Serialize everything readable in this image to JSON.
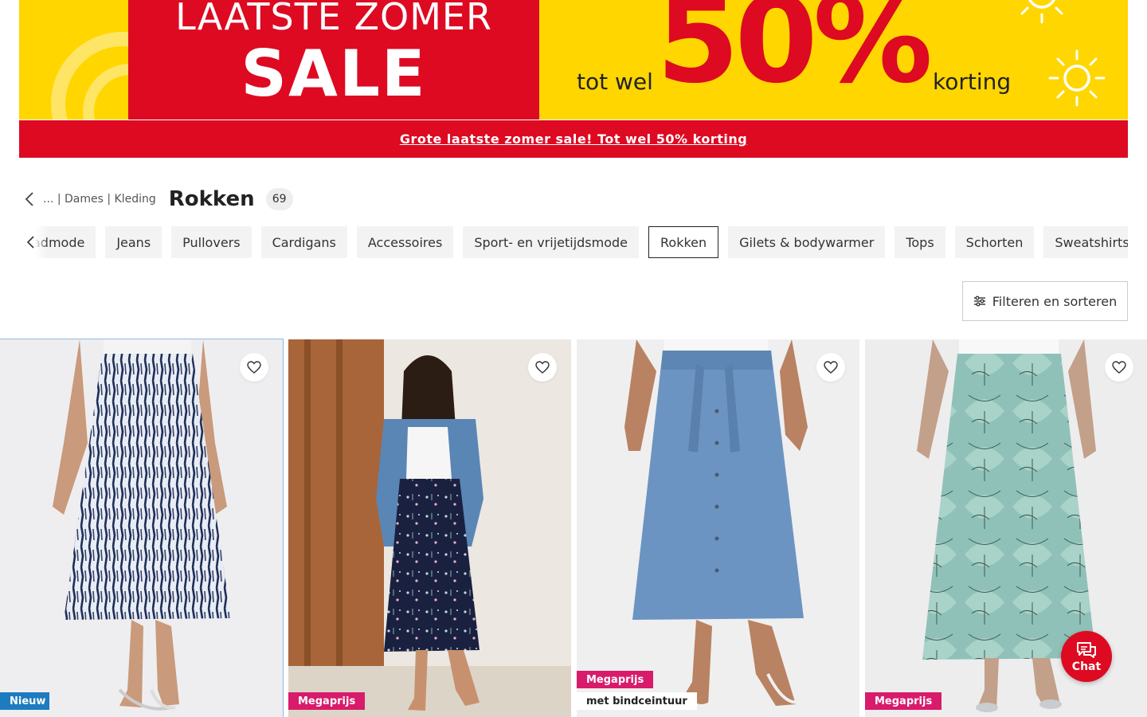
{
  "banner": {
    "line1": "LAATSTE ZOMER",
    "line2": "SALE",
    "prefix": "tot wel",
    "percent": "50%",
    "suffix": "korting"
  },
  "promo_link": "Grote laatste zomer sale! Tot wel 50% korting",
  "breadcrumb": {
    "items": [
      "...",
      "|",
      "Dames",
      "|",
      "Kleding"
    ],
    "title": "Rokken",
    "count": "69"
  },
  "categories": [
    {
      "label": "Badmode",
      "active": false
    },
    {
      "label": "Jeans",
      "active": false
    },
    {
      "label": "Pullovers",
      "active": false
    },
    {
      "label": "Cardigans",
      "active": false
    },
    {
      "label": "Accessoires",
      "active": false
    },
    {
      "label": "Sport- en vrijetijdsmode",
      "active": false
    },
    {
      "label": "Rokken",
      "active": true
    },
    {
      "label": "Gilets & bodywarmer",
      "active": false
    },
    {
      "label": "Tops",
      "active": false
    },
    {
      "label": "Schorten",
      "active": false
    },
    {
      "label": "Sweatshirts",
      "active": false
    }
  ],
  "filter": {
    "label": "Filteren en sorteren"
  },
  "products": [
    {
      "badges": [
        "Nieuw"
      ]
    },
    {
      "badges": [
        "Megaprijs"
      ]
    },
    {
      "badges": [
        "Megaprijs",
        "met bindceintuur"
      ]
    },
    {
      "badges": [
        "Megaprijs"
      ]
    }
  ],
  "chat": {
    "label": "Chat"
  },
  "colors": {
    "brand_red": "#dd0a22",
    "banner_yellow": "#ffd600",
    "badge_new": "#1d7bbf",
    "badge_mega": "#d81b6a"
  }
}
